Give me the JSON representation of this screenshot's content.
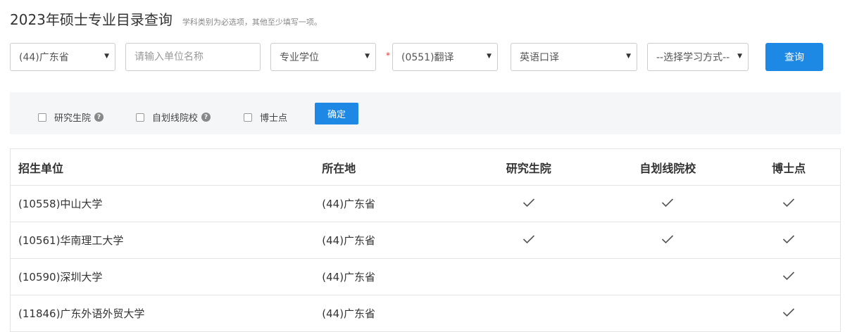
{
  "header": {
    "title": "2023年硕士专业目录查询",
    "hint": "学科类别为必选项，其他至少填写一项。"
  },
  "search": {
    "province": "(44)广东省",
    "unit_placeholder": "请输入单位名称",
    "degree_type": "专业学位",
    "required_mark": "*",
    "subject": "(0551)翻译",
    "direction": "英语口译",
    "study_mode": "--选择学习方式--",
    "query_label": "查询"
  },
  "filters": {
    "items": [
      {
        "label": "研究生院",
        "checked": false,
        "help": "?"
      },
      {
        "label": "自划线院校",
        "checked": false,
        "help": "?"
      },
      {
        "label": "博士点",
        "checked": false
      }
    ],
    "confirm_label": "确定"
  },
  "table": {
    "headers": [
      "招生单位",
      "所在地",
      "研究生院",
      "自划线院校",
      "博士点"
    ],
    "rows": [
      {
        "unit": "(10558)中山大学",
        "location": "(44)广东省",
        "grad_school": true,
        "self_line": true,
        "doctoral": true
      },
      {
        "unit": "(10561)华南理工大学",
        "location": "(44)广东省",
        "grad_school": true,
        "self_line": true,
        "doctoral": true
      },
      {
        "unit": "(10590)深圳大学",
        "location": "(44)广东省",
        "grad_school": false,
        "self_line": false,
        "doctoral": true
      },
      {
        "unit": "(11846)广东外语外贸大学",
        "location": "(44)广东省",
        "grad_school": false,
        "self_line": false,
        "doctoral": true
      }
    ]
  },
  "icons": {
    "dropdown": "caret-down-icon",
    "help": "question-circle-icon",
    "check": "checkmark-icon"
  },
  "colors": {
    "primary": "#1e88e5",
    "filter_bg": "#f4f6f8",
    "required": "#e33333"
  }
}
